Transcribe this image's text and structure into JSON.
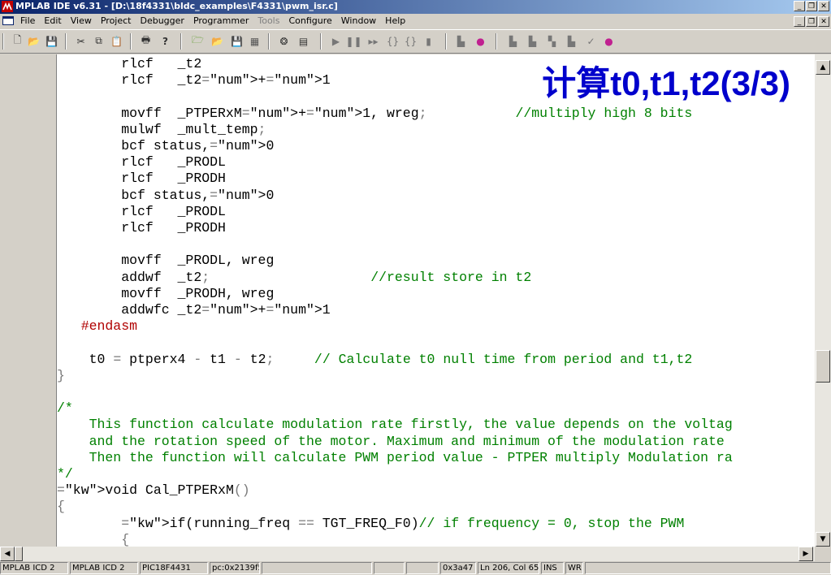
{
  "window": {
    "title": "MPLAB IDE v6.31 - [D:\\18f4331\\bldc_examples\\F4331\\pwm_isr.c]"
  },
  "menu": {
    "items": [
      "File",
      "Edit",
      "View",
      "Project",
      "Debugger",
      "Programmer",
      "Tools",
      "Configure",
      "Window",
      "Help"
    ],
    "disabled": [
      "Tools"
    ]
  },
  "toolbar": {
    "icons": [
      "new-file-icon",
      "open-folder-icon",
      "save-icon",
      "cut-icon",
      "copy-icon",
      "paste-icon",
      "print-icon",
      "help-icon",
      "new-project-icon",
      "open-project-icon",
      "save-project-icon",
      "build-icon",
      "find-icon",
      "workspace-icon",
      "run-icon",
      "halt-icon",
      "animate-icon",
      "step-into-icon",
      "step-over-icon",
      "reset-icon",
      "program-icon",
      "target-icon",
      "read-device-icon",
      "verify-icon",
      "blank-check-icon",
      "erase-icon",
      "checkmark-icon",
      "debugger-icon"
    ]
  },
  "slide_title": "计算t0,t1,t2(3/3)",
  "code": {
    "lines": [
      "        rlcf   _t2",
      "        rlcf   _t2+1",
      "",
      "        movff  _PTPERxM+1, wreg;           //multiply high 8 bits",
      "        mulwf  _mult_temp;",
      "        bcf status,0",
      "        rlcf   _PRODL",
      "        rlcf   _PRODH",
      "        bcf status,0",
      "        rlcf   _PRODL",
      "        rlcf   _PRODH",
      "",
      "        movff  _PRODL, wreg",
      "        addwf  _t2;                    //result store in t2",
      "        movff  _PRODH, wreg",
      "        addwfc _t2+1",
      "   #endasm",
      "",
      "    t0 = ptperx4 - t1 - t2;     // Calculate t0 null time from period and t1,t2",
      "}",
      "",
      "/*",
      "    This function calculate modulation rate firstly, the value depends on the voltag",
      "    and the rotation speed of the motor. Maximum and minimum of the modulation rate",
      "    Then the function will calculate PWM period value - PTPER multiply Modulation ra",
      "*/",
      "void Cal_PTPERxM()",
      "{",
      "        if(running_freq == TGT_FREQ_F0)// if frequency = 0, stop the PWM",
      "        {"
    ]
  },
  "status": {
    "fields": [
      "MPLAB ICD 2",
      "MPLAB ICD 2",
      "PIC18F4431",
      "pc:0x2139f5",
      "",
      "",
      "",
      "",
      "0x3a47",
      "Ln 206, Col 65",
      "INS",
      "WR"
    ]
  },
  "colors": {
    "keyword": "#00008b",
    "comment": "#008000",
    "number": "#00aa00",
    "preprocessor": "#b00000",
    "title_text": "#0000cc"
  }
}
